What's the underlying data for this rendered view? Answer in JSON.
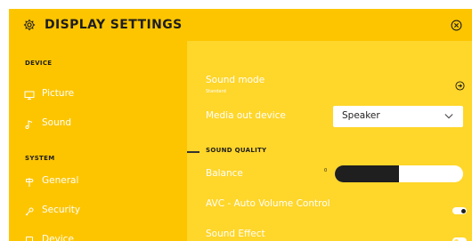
{
  "header": {
    "title": "DISPLAY SETTINGS",
    "settings_icon": "gear-icon",
    "close_icon": "close-circle-icon"
  },
  "sidebar": {
    "sections": [
      {
        "title": "DEVICE",
        "items": [
          {
            "label": "Picture",
            "icon": "monitor-icon"
          },
          {
            "label": "Sound",
            "icon": "music-note-icon"
          }
        ]
      },
      {
        "title": "SYSTEM",
        "items": [
          {
            "label": "General",
            "icon": "signpost-icon"
          },
          {
            "label": "Security",
            "icon": "key-icon"
          },
          {
            "label": "Device",
            "icon": "device-icon"
          }
        ]
      }
    ]
  },
  "main": {
    "sound_mode": {
      "label": "Sound mode",
      "value": "Standard",
      "icon": "arrow-right-circle-icon"
    },
    "media_out": {
      "label": "Media out device",
      "selected": "Speaker"
    },
    "sound_quality": {
      "title": "SOUND QUALITY"
    },
    "balance": {
      "label": "Balance",
      "min_label": "0",
      "level": 0.5
    },
    "avc": {
      "label": "AVC - Auto Volume Control",
      "on": true
    },
    "sound_effect": {
      "label": "Sound Effect",
      "on": false
    }
  },
  "colors": {
    "panel": "#ffd62a",
    "sidebar": "#fdc500",
    "text_light": "#ffffff",
    "text_dark": "#1d1d1d"
  }
}
